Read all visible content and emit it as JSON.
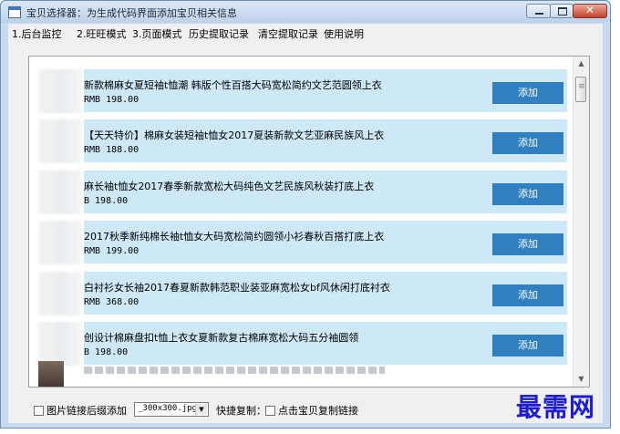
{
  "window": {
    "title": "宝贝选择器：为生成代码界面添加宝贝相关信息",
    "close_glyph": "✕"
  },
  "menu": [
    {
      "label": "1.后台监控"
    },
    {
      "label": "2.旺旺模式"
    },
    {
      "label": "3.页面模式"
    },
    {
      "label": "历史提取记录"
    },
    {
      "label": "清空提取记录"
    },
    {
      "label": "使用说明"
    }
  ],
  "items": [
    {
      "title": "新款棉麻女夏短袖t恤潮 韩版个性百搭大码宽松简约文艺范圆领上衣",
      "price": "RMB 198.00",
      "button": "添加"
    },
    {
      "title": "【天天特价】棉麻女装短袖t恤女2017夏装新款文艺亚麻民族风上衣",
      "price": "RMB 188.00",
      "button": "添加"
    },
    {
      "title": "麻长袖t恤女2017春季新款宽松大码纯色文艺民族风秋装打底上衣",
      "price": "B 198.00",
      "button": "添加"
    },
    {
      "title": "2017秋季新纯棉长袖t恤女大码宽松简约圆领小衫春秋百搭打底上衣",
      "price": "RMB 199.00",
      "button": "添加"
    },
    {
      "title": "白衬衫女长袖2017春夏新款韩范职业装亚麻宽松女bf风休闲打底衬衣",
      "price": "RMB 368.00",
      "button": "添加"
    },
    {
      "title": "创设计棉麻盘扣t恤上衣女夏新款复古棉麻宽松大码五分袖圆领",
      "price": "B 198.00",
      "button": "添加"
    }
  ],
  "bottom": {
    "image_link_label": "图片链接后缀添加",
    "image_size_value": "_300x300.jpg",
    "quick_copy_label": "快捷复制：",
    "click_copy_label": "点击宝贝复制链接"
  },
  "watermark": "最需网",
  "colors": {
    "row_bg": "#cde8f6",
    "button_bg": "#2f7fc1",
    "watermark": "#1c1bd6"
  }
}
